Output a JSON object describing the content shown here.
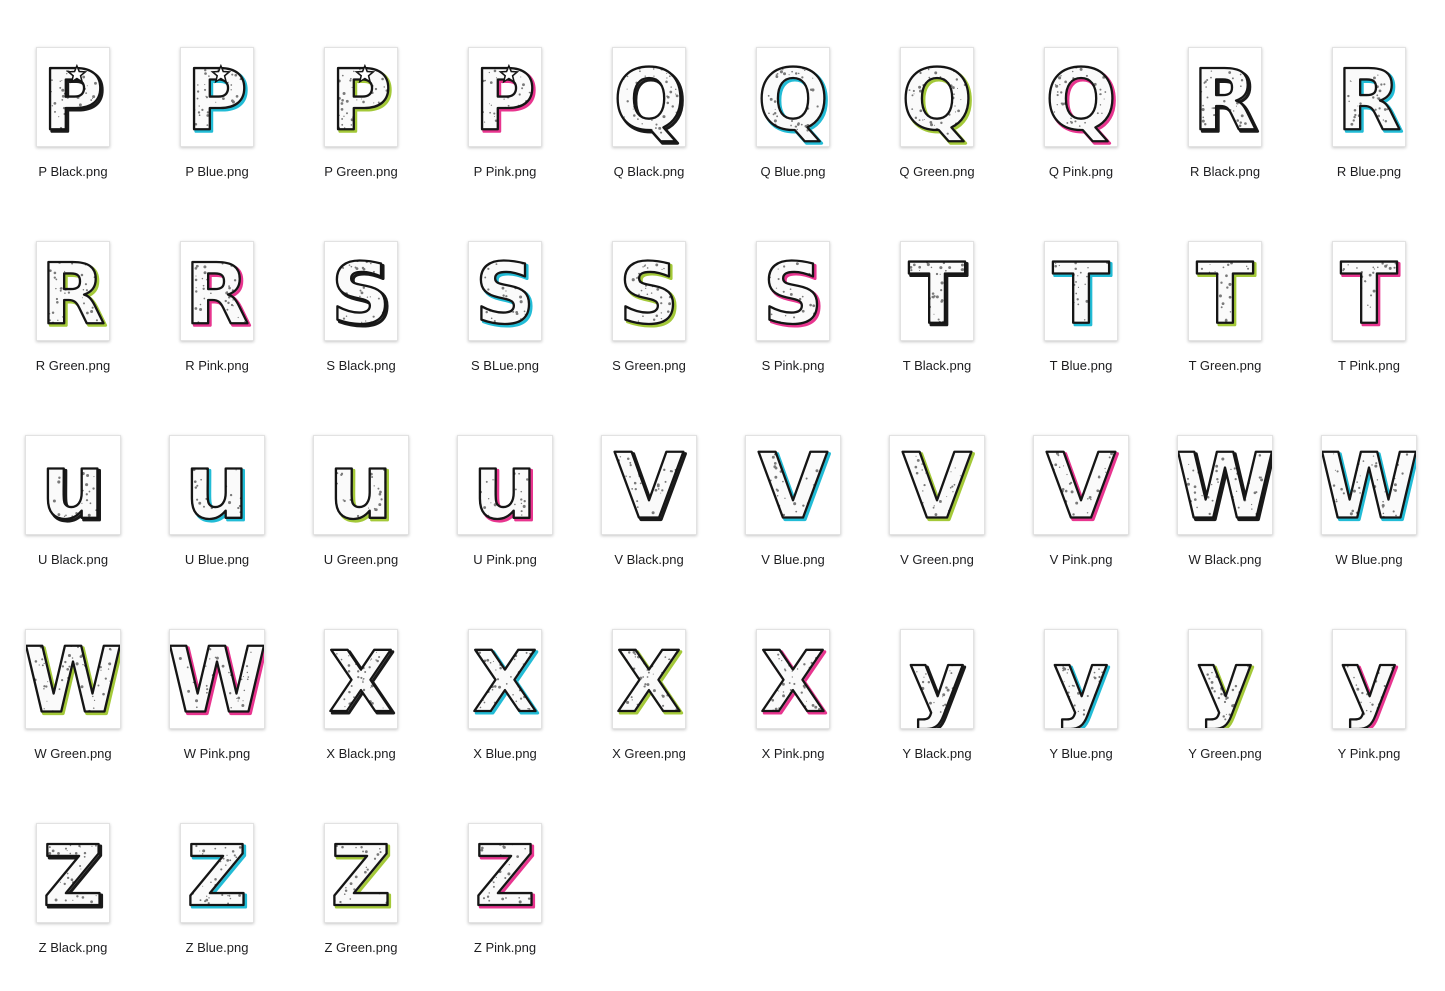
{
  "window": {
    "title": ""
  },
  "colors": {
    "Black": "#1a1a1a",
    "Blue": "#22bcd6",
    "Green": "#a4c939",
    "Pink": "#e8358f"
  },
  "files": [
    {
      "name": "P Black.png",
      "letter": "P",
      "color": "Black",
      "icon": "png-file-thumbnail"
    },
    {
      "name": "P Blue.png",
      "letter": "P",
      "color": "Blue",
      "icon": "png-file-thumbnail"
    },
    {
      "name": "P Green.png",
      "letter": "P",
      "color": "Green",
      "icon": "png-file-thumbnail"
    },
    {
      "name": "P Pink.png",
      "letter": "P",
      "color": "Pink",
      "icon": "png-file-thumbnail"
    },
    {
      "name": "Q Black.png",
      "letter": "Q",
      "color": "Black",
      "icon": "png-file-thumbnail"
    },
    {
      "name": "Q Blue.png",
      "letter": "Q",
      "color": "Blue",
      "icon": "png-file-thumbnail"
    },
    {
      "name": "Q Green.png",
      "letter": "Q",
      "color": "Green",
      "icon": "png-file-thumbnail"
    },
    {
      "name": "Q Pink.png",
      "letter": "Q",
      "color": "Pink",
      "icon": "png-file-thumbnail"
    },
    {
      "name": "R Black.png",
      "letter": "R",
      "color": "Black",
      "icon": "png-file-thumbnail"
    },
    {
      "name": "R Blue.png",
      "letter": "R",
      "color": "Blue",
      "icon": "png-file-thumbnail"
    },
    {
      "name": "R Green.png",
      "letter": "R",
      "color": "Green",
      "icon": "png-file-thumbnail"
    },
    {
      "name": "R Pink.png",
      "letter": "R",
      "color": "Pink",
      "icon": "png-file-thumbnail"
    },
    {
      "name": "S Black.png",
      "letter": "S",
      "color": "Black",
      "icon": "png-file-thumbnail"
    },
    {
      "name": "S BLue.png",
      "letter": "S",
      "color": "Blue",
      "icon": "png-file-thumbnail"
    },
    {
      "name": "S Green.png",
      "letter": "S",
      "color": "Green",
      "icon": "png-file-thumbnail"
    },
    {
      "name": "S Pink.png",
      "letter": "S",
      "color": "Pink",
      "icon": "png-file-thumbnail"
    },
    {
      "name": "T Black.png",
      "letter": "T",
      "color": "Black",
      "icon": "png-file-thumbnail"
    },
    {
      "name": "T Blue.png",
      "letter": "T",
      "color": "Blue",
      "icon": "png-file-thumbnail"
    },
    {
      "name": "T Green.png",
      "letter": "T",
      "color": "Green",
      "icon": "png-file-thumbnail"
    },
    {
      "name": "T Pink.png",
      "letter": "T",
      "color": "Pink",
      "icon": "png-file-thumbnail"
    },
    {
      "name": "U Black.png",
      "letter": "u",
      "color": "Black",
      "icon": "png-file-thumbnail",
      "wide": true
    },
    {
      "name": "U Blue.png",
      "letter": "u",
      "color": "Blue",
      "icon": "png-file-thumbnail",
      "wide": true
    },
    {
      "name": "U Green.png",
      "letter": "u",
      "color": "Green",
      "icon": "png-file-thumbnail",
      "wide": true
    },
    {
      "name": "U Pink.png",
      "letter": "u",
      "color": "Pink",
      "icon": "png-file-thumbnail",
      "wide": true
    },
    {
      "name": "V Black.png",
      "letter": "V",
      "color": "Black",
      "icon": "png-file-thumbnail",
      "wide": true
    },
    {
      "name": "V Blue.png",
      "letter": "V",
      "color": "Blue",
      "icon": "png-file-thumbnail",
      "wide": true
    },
    {
      "name": "V Green.png",
      "letter": "V",
      "color": "Green",
      "icon": "png-file-thumbnail",
      "wide": true
    },
    {
      "name": "V Pink.png",
      "letter": "V",
      "color": "Pink",
      "icon": "png-file-thumbnail",
      "wide": true
    },
    {
      "name": "W Black.png",
      "letter": "W",
      "color": "Black",
      "icon": "png-file-thumbnail",
      "wide": true
    },
    {
      "name": "W Blue.png",
      "letter": "W",
      "color": "Blue",
      "icon": "png-file-thumbnail",
      "wide": true
    },
    {
      "name": "W Green.png",
      "letter": "W",
      "color": "Green",
      "icon": "png-file-thumbnail",
      "wide": true
    },
    {
      "name": "W Pink.png",
      "letter": "W",
      "color": "Pink",
      "icon": "png-file-thumbnail",
      "wide": true
    },
    {
      "name": "X Black.png",
      "letter": "X",
      "color": "Black",
      "icon": "png-file-thumbnail"
    },
    {
      "name": "X Blue.png",
      "letter": "X",
      "color": "Blue",
      "icon": "png-file-thumbnail"
    },
    {
      "name": "X Green.png",
      "letter": "X",
      "color": "Green",
      "icon": "png-file-thumbnail"
    },
    {
      "name": "X Pink.png",
      "letter": "X",
      "color": "Pink",
      "icon": "png-file-thumbnail"
    },
    {
      "name": "Y Black.png",
      "letter": "y",
      "color": "Black",
      "icon": "png-file-thumbnail"
    },
    {
      "name": "Y Blue.png",
      "letter": "y",
      "color": "Blue",
      "icon": "png-file-thumbnail"
    },
    {
      "name": "Y Green.png",
      "letter": "y",
      "color": "Green",
      "icon": "png-file-thumbnail"
    },
    {
      "name": "Y Pink.png",
      "letter": "y",
      "color": "Pink",
      "icon": "png-file-thumbnail"
    },
    {
      "name": "Z Black.png",
      "letter": "Z",
      "color": "Black",
      "icon": "png-file-thumbnail"
    },
    {
      "name": "Z Blue.png",
      "letter": "Z",
      "color": "Blue",
      "icon": "png-file-thumbnail"
    },
    {
      "name": "Z Green.png",
      "letter": "Z",
      "color": "Green",
      "icon": "png-file-thumbnail"
    },
    {
      "name": "Z Pink.png",
      "letter": "Z",
      "color": "Pink",
      "icon": "png-file-thumbnail"
    }
  ]
}
